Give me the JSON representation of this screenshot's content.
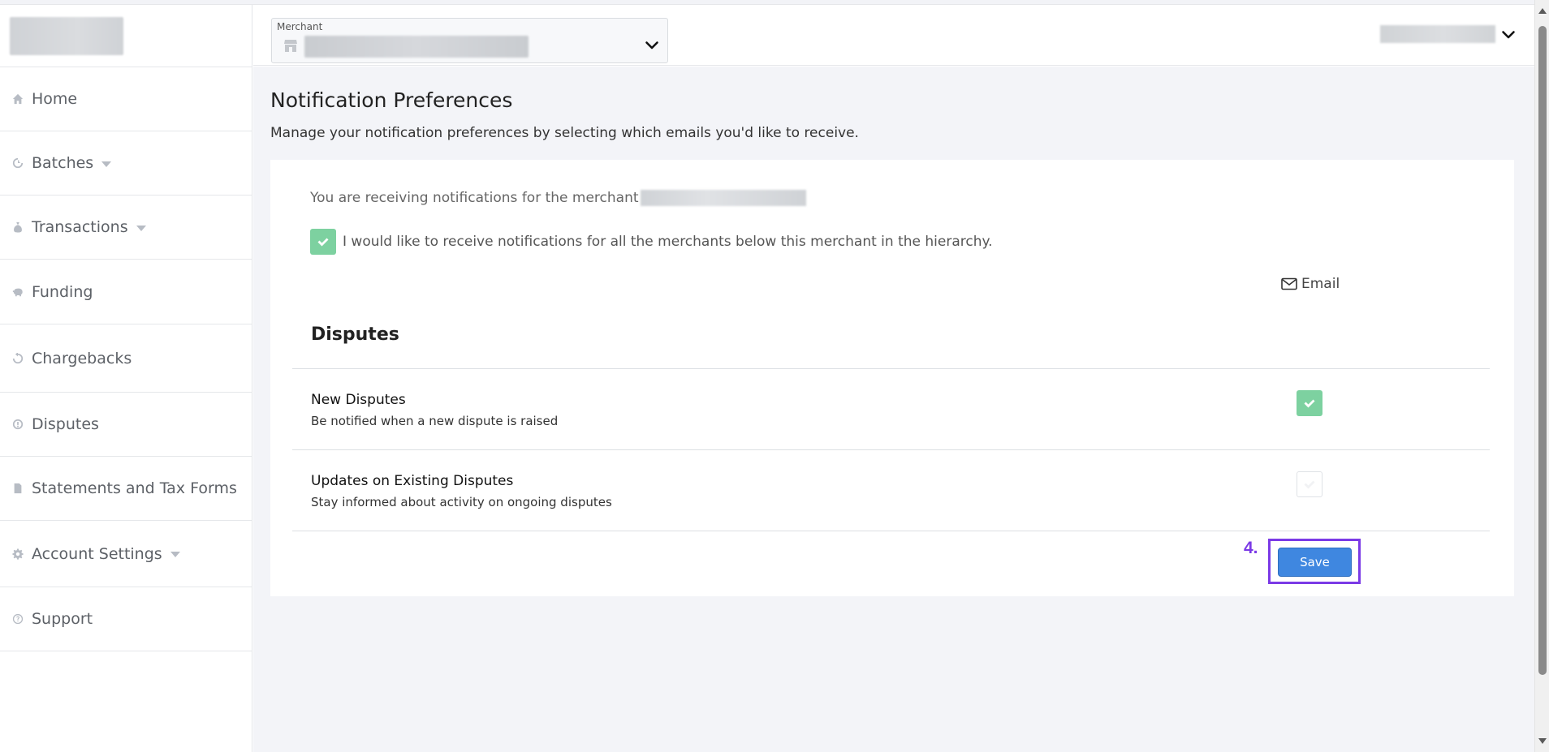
{
  "header": {
    "merchant_label": "Merchant"
  },
  "sidebar": {
    "items": [
      {
        "label": "Home",
        "icon": "home-icon",
        "has_caret": false
      },
      {
        "label": "Batches",
        "icon": "batches-icon",
        "has_caret": true
      },
      {
        "label": "Transactions",
        "icon": "money-bag-icon",
        "has_caret": true
      },
      {
        "label": "Funding",
        "icon": "piggy-bank-icon",
        "has_caret": false
      },
      {
        "label": "Chargebacks",
        "icon": "chargeback-icon",
        "has_caret": false
      },
      {
        "label": "Disputes",
        "icon": "dispute-icon",
        "has_caret": false
      },
      {
        "label": "Statements and Tax Forms",
        "icon": "document-icon",
        "has_caret": false
      },
      {
        "label": "Account Settings",
        "icon": "gear-icon",
        "has_caret": true
      },
      {
        "label": "Support",
        "icon": "help-icon",
        "has_caret": false
      }
    ]
  },
  "main": {
    "title": "Notification Preferences",
    "subtitle": "Manage your notification preferences by selecting which emails you'd like to receive.",
    "receiving_text": "You are receiving notifications for the merchant",
    "hierarchy_label": "I would like to receive notifications for all the merchants below this merchant in the hierarchy.",
    "hierarchy_checked": true,
    "email_column_label": "Email",
    "section_title": "Disputes",
    "rows": [
      {
        "title": "New Disputes",
        "description": "Be notified when a new dispute is raised",
        "checked": true
      },
      {
        "title": "Updates on Existing Disputes",
        "description": "Stay informed about activity on ongoing disputes",
        "checked": false
      }
    ],
    "step_number": "4.",
    "save_label": "Save"
  },
  "colors": {
    "accent": "#3f87e0",
    "checkbox_checked": "#7dd1a0",
    "highlight": "#7b3ae6",
    "main_background": "#f3f4f8"
  }
}
